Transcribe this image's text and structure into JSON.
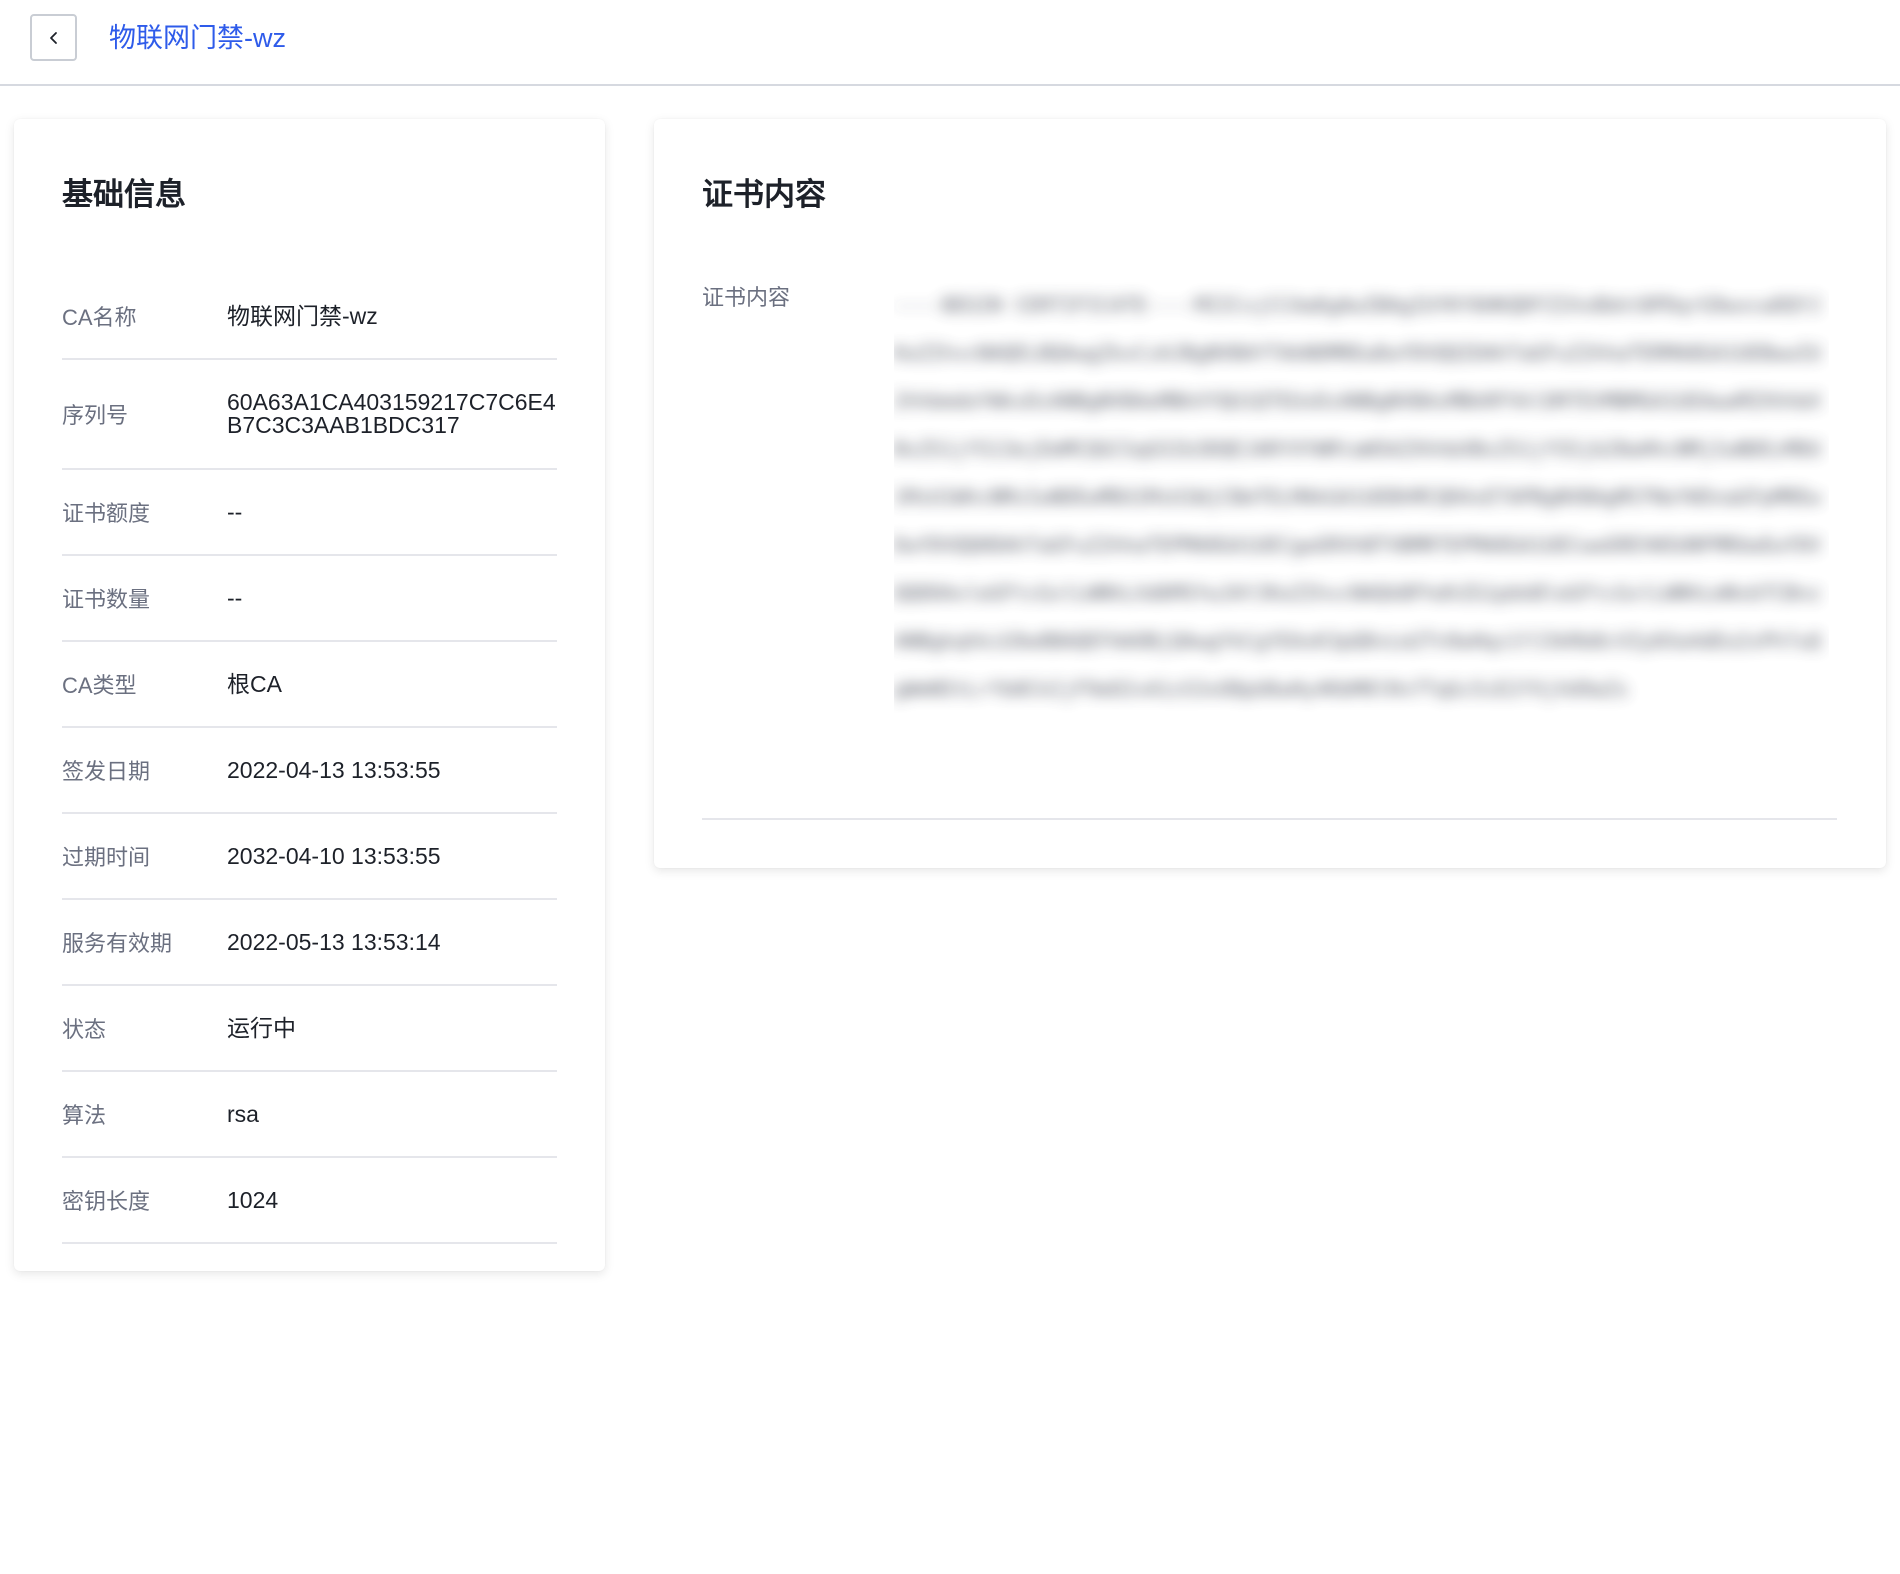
{
  "header": {
    "back_icon": "chevron-left-icon",
    "title": "物联网门禁-wz",
    "title_color": "#2e5bea"
  },
  "basic_info": {
    "title": "基础信息",
    "rows": [
      {
        "label": "CA名称",
        "value": "物联网门禁-wz"
      },
      {
        "label": "序列号",
        "value": "60A63A1CA403159217C7C6E4B7C3C3AAB1BDC317"
      },
      {
        "label": "证书额度",
        "value": "--"
      },
      {
        "label": "证书数量",
        "value": "--"
      },
      {
        "label": "CA类型",
        "value": "根CA"
      },
      {
        "label": "签发日期",
        "value": "2022-04-13 13:53:55"
      },
      {
        "label": "过期时间",
        "value": "2032-04-10 13:53:55"
      },
      {
        "label": "服务有效期",
        "value": "2022-05-13 13:53:14"
      },
      {
        "label": "状态",
        "value": "运行中"
      },
      {
        "label": "算法",
        "value": "rsa"
      },
      {
        "label": "密钥长度",
        "value": "1024"
      }
    ]
  },
  "cert_content": {
    "title": "证书内容",
    "label": "证书内容",
    "blurred": true
  }
}
